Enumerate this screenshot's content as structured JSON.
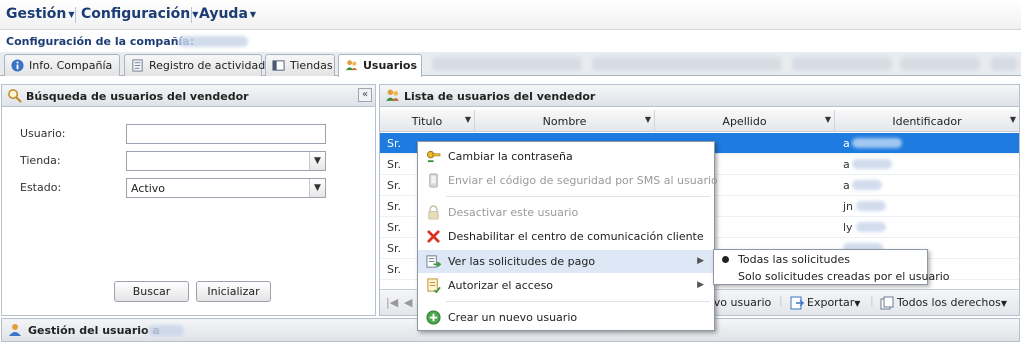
{
  "menu": {
    "items": [
      "Gestión",
      "Configuración",
      "Ayuda"
    ]
  },
  "company": {
    "label": "Configuración de la compañía:"
  },
  "tabs": [
    {
      "label": "Info. Compañía",
      "icon": "info-icon"
    },
    {
      "label": "Registro de actividad",
      "icon": "log-icon"
    },
    {
      "label": "Tiendas",
      "icon": "store-icon"
    },
    {
      "label": "Usuarios",
      "icon": "users-icon",
      "active": true
    }
  ],
  "search_panel": {
    "title": "Búsqueda de usuarios del vendedor",
    "collapse": "«",
    "fields": {
      "user_label": "Usuario:",
      "user_value": "",
      "store_label": "Tienda:",
      "store_value": "",
      "state_label": "Estado:",
      "state_value": "Activo"
    },
    "buttons": {
      "search": "Buscar",
      "reset": "Inicializar"
    }
  },
  "list_panel": {
    "title": "Lista de usuarios del vendedor",
    "columns": [
      "Titulo",
      "Nombre",
      "Apellido",
      "Identificador"
    ],
    "rows": [
      {
        "title": "Sr.",
        "id": "a"
      },
      {
        "title": "Sr.",
        "id": "a"
      },
      {
        "title": "Sr.",
        "id": "a"
      },
      {
        "title": "Sr.",
        "id": "jn"
      },
      {
        "title": "Sr.",
        "id": "ly"
      },
      {
        "title": "Sr.",
        "id": ""
      },
      {
        "title": "Sr.",
        "id": ""
      }
    ],
    "footer": {
      "new_user": "evo usuario",
      "export": "Exportar",
      "all_rights": "Todos los derechos"
    }
  },
  "bottom": {
    "title": "Gestión del usuario a"
  },
  "context_menu": {
    "items": [
      {
        "label": "Cambiar la contraseña",
        "icon": "key-icon",
        "disabled": false
      },
      {
        "label": "Enviar el código de seguridad por SMS al usuario",
        "icon": "phone-icon",
        "disabled": true
      },
      {
        "label": "Desactivar este usuario",
        "icon": "lock-icon",
        "disabled": true
      },
      {
        "label": "Deshabilitar el centro de comunicación cliente",
        "icon": "close-icon",
        "disabled": false
      },
      {
        "label": "Ver las solicitudes de pago",
        "icon": "payment-icon",
        "disabled": false,
        "submenu": true
      },
      {
        "label": "Autorizar el acceso",
        "icon": "authorize-icon",
        "disabled": false,
        "submenu": true
      },
      {
        "label": "Crear un nuevo usuario",
        "icon": "add-icon",
        "disabled": false
      }
    ],
    "submenu": [
      {
        "label": "Todas las solicitudes",
        "selected": true
      },
      {
        "label": "Solo solicitudes creadas por el usuario",
        "selected": false
      }
    ]
  },
  "colors": {
    "accent": "#1b3c74",
    "selection": "#1e7be0",
    "hover": "#dde7f5"
  }
}
